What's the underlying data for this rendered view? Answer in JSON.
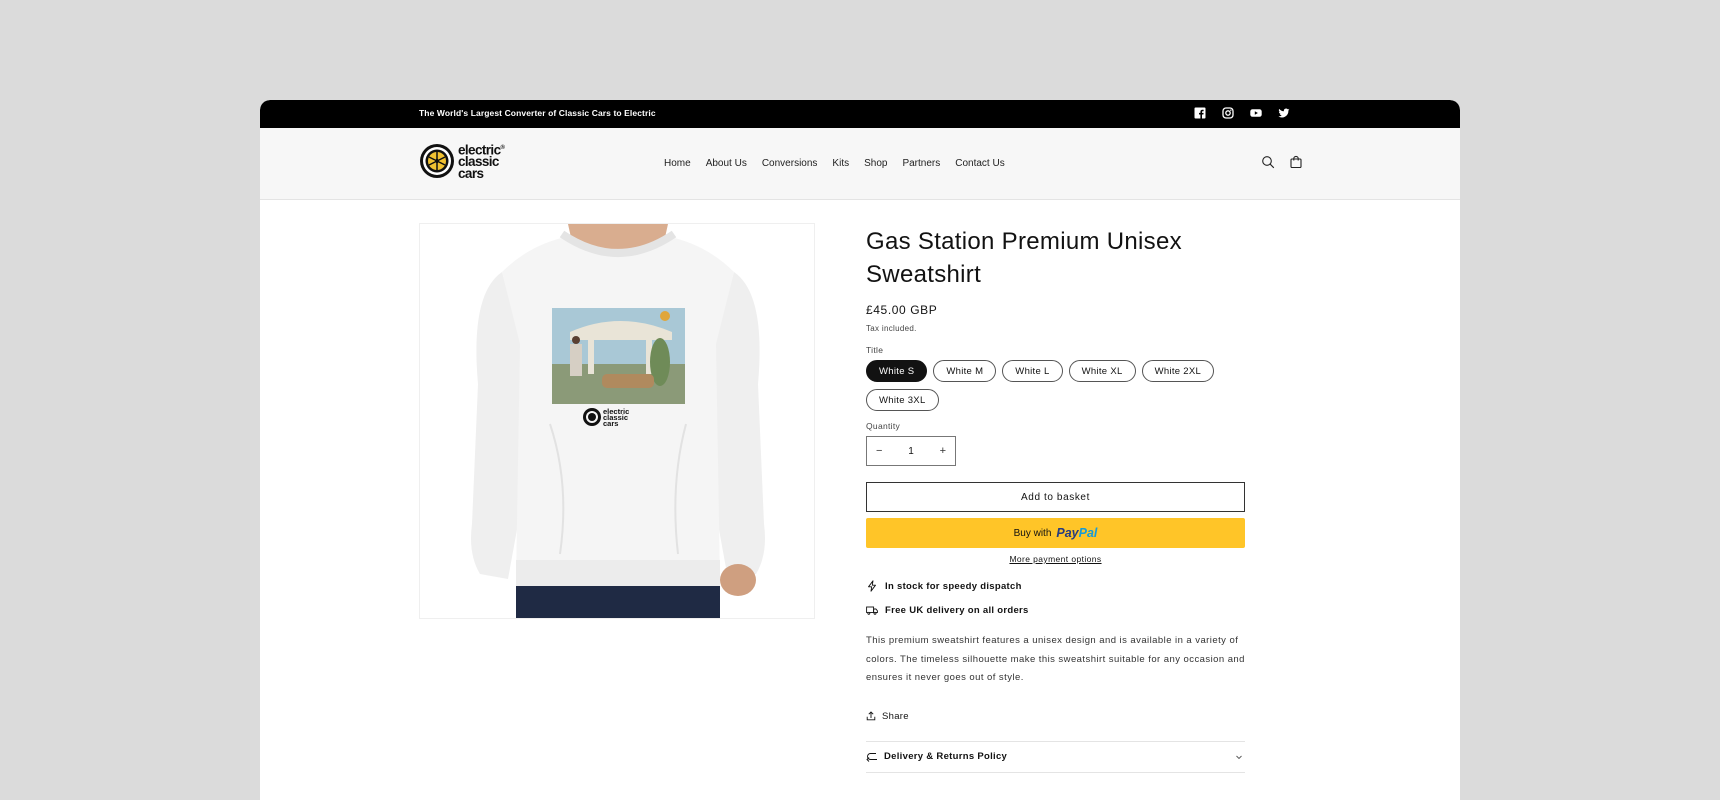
{
  "announcement": {
    "text": "The World's Largest Converter of Classic Cars to Electric"
  },
  "social": [
    "facebook-icon",
    "instagram-icon",
    "youtube-icon",
    "twitter-icon"
  ],
  "logo": {
    "line1": "electric",
    "line2": "classic",
    "line3": "cars",
    "reg": "®"
  },
  "nav": [
    "Home",
    "About Us",
    "Conversions",
    "Kits",
    "Shop",
    "Partners",
    "Contact Us"
  ],
  "header_icons": [
    "search-icon",
    "cart-icon"
  ],
  "product": {
    "title": "Gas Station Premium Unisex Sweatshirt",
    "price": "£45.00 GBP",
    "tax": "Tax included.",
    "option_label": "Title",
    "variants": [
      "White S",
      "White M",
      "White L",
      "White XL",
      "White 2XL",
      "White 3XL"
    ],
    "selected_variant": "White S",
    "quantity_label": "Quantity",
    "quantity": "1",
    "add_to_basket": "Add to basket",
    "buy_with": "Buy with",
    "paypal_1": "Pay",
    "paypal_2": "Pal",
    "more_payment": "More payment options",
    "features": [
      "In stock for speedy dispatch",
      "Free UK delivery on all orders"
    ],
    "description": "This premium sweatshirt features a unisex design and is available in a variety of colors. The timeless silhouette make this sweatshirt suitable for any occasion and ensures it never goes out of style.",
    "share": "Share",
    "accordion": "Delivery & Returns Policy",
    "print_logo_text": "electric classic cars"
  },
  "colors": {
    "accent_black": "#000000",
    "paypal_yellow": "#ffc528",
    "header_bg": "#f7f7f7",
    "page_bg": "#dbdbdb"
  }
}
